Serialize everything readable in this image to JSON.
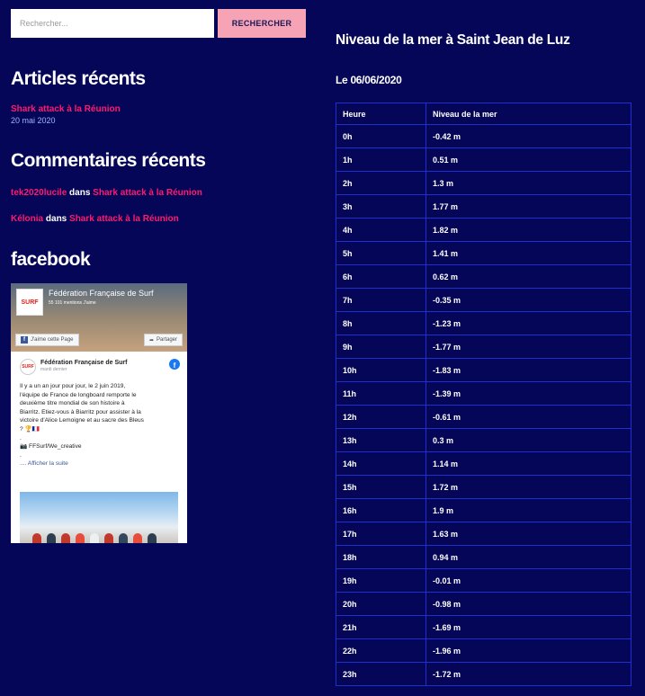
{
  "search": {
    "placeholder": "Rechercher...",
    "button_label": "RECHERCHER"
  },
  "recent_articles": {
    "title": "Articles récents",
    "items": [
      {
        "label": "Shark attack à la Réunion",
        "date": "20 mai 2020"
      }
    ]
  },
  "recent_comments": {
    "title": "Commentaires récents",
    "items": [
      {
        "author": "tek2020lucile",
        "connector": " dans ",
        "post": "Shark attack à la Réunion"
      },
      {
        "author": "Kélonia",
        "connector": " dans ",
        "post": "Shark attack à la Réunion"
      }
    ]
  },
  "facebook": {
    "title": "facebook",
    "page_name": "Fédération Française de Surf",
    "likes": "55 101 mentions J'aime",
    "like_button": "J'aime cette Page",
    "share_button": "Partager",
    "logo_text": "SURF",
    "post_author": "Fédération Française de Surf",
    "post_date": "mardi dernier",
    "post_lines": [
      "Il y a un an jour pour jour, le 2 juin 2019,",
      "l'équipe de France de longboard remporte le",
      "deuxième titre mondial de son histoire à",
      "Biarritz. Etiez-vous à Biarritz pour assister à la",
      "victoire d'Alice Lemoigne et au sacre des Bleus",
      "? 🏆🇫🇷",
      ".",
      "📷 FFSurf/We_creative",
      ".",
      ".... Afficher la suite"
    ]
  },
  "tide": {
    "title": "Niveau de la mer à Saint Jean de Luz",
    "date": "Le 06/06/2020",
    "headers": [
      "Heure",
      "Niveau de la mer"
    ],
    "rows": [
      [
        "0h",
        "-0.42 m"
      ],
      [
        "1h",
        "0.51 m"
      ],
      [
        "2h",
        "1.3 m"
      ],
      [
        "3h",
        "1.77 m"
      ],
      [
        "4h",
        "1.82 m"
      ],
      [
        "5h",
        "1.41 m"
      ],
      [
        "6h",
        "0.62 m"
      ],
      [
        "7h",
        "-0.35 m"
      ],
      [
        "8h",
        "-1.23 m"
      ],
      [
        "9h",
        "-1.77 m"
      ],
      [
        "10h",
        "-1.83 m"
      ],
      [
        "11h",
        "-1.39 m"
      ],
      [
        "12h",
        "-0.61 m"
      ],
      [
        "13h",
        "0.3 m"
      ],
      [
        "14h",
        "1.14 m"
      ],
      [
        "15h",
        "1.72 m"
      ],
      [
        "16h",
        "1.9 m"
      ],
      [
        "17h",
        "1.63 m"
      ],
      [
        "18h",
        "0.94 m"
      ],
      [
        "19h",
        "-0.01 m"
      ],
      [
        "20h",
        "-0.98 m"
      ],
      [
        "21h",
        "-1.69 m"
      ],
      [
        "22h",
        "-1.96 m"
      ],
      [
        "23h",
        "-1.72 m"
      ]
    ]
  },
  "colors": {
    "background": "#050657",
    "accent_pink": "#ff1a6e",
    "button_pink": "#f5a3b5",
    "date_blue": "#9db4ff",
    "table_border": "#1f2fcc"
  }
}
